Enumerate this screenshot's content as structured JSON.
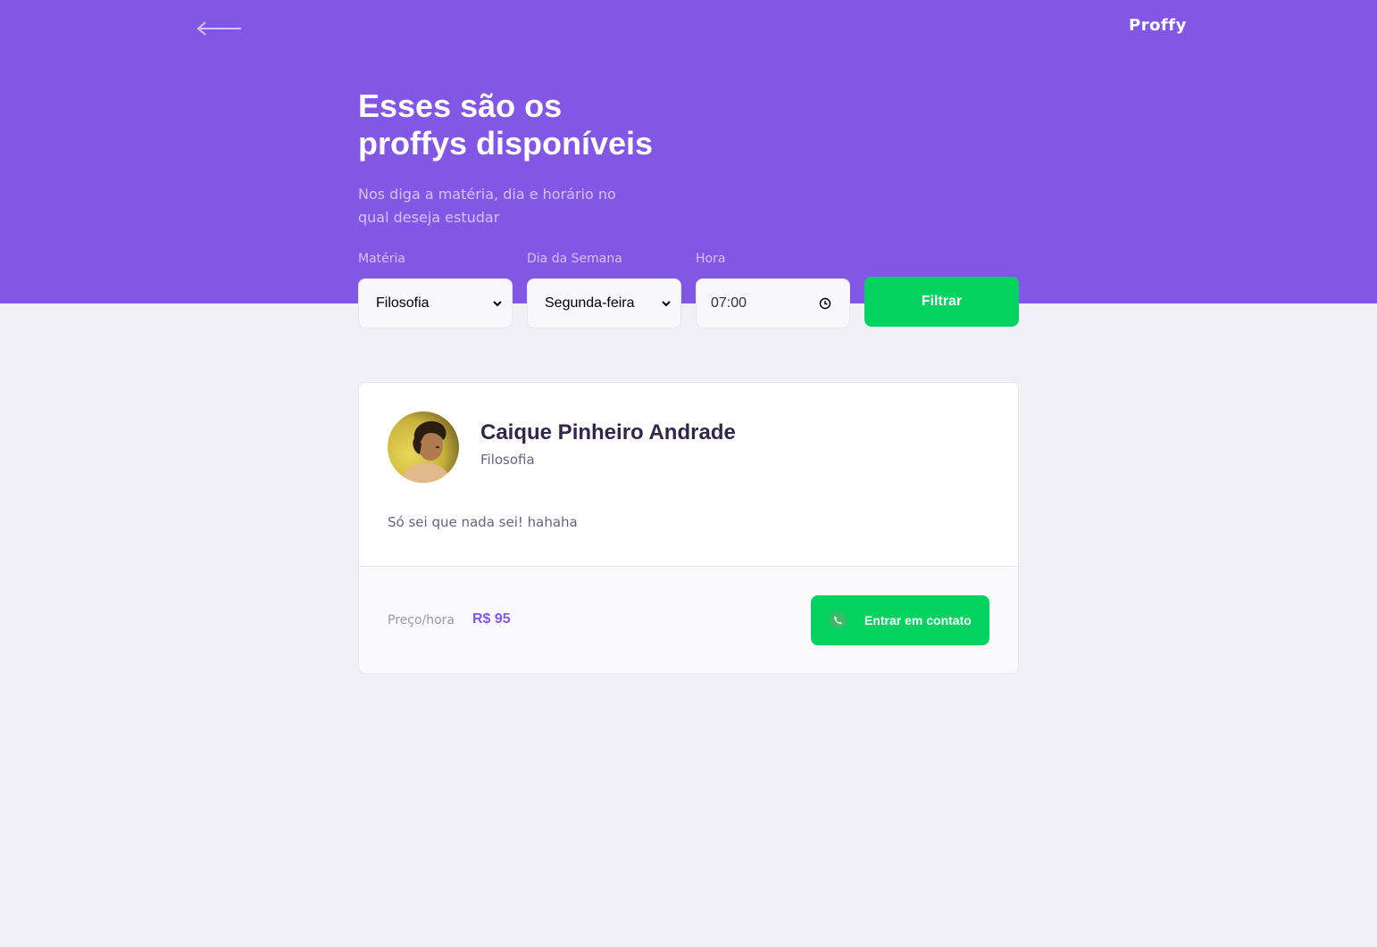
{
  "header": {
    "logo": "Proffy",
    "title_line1": "Esses são os",
    "title_line2": "proffys disponíveis",
    "subtitle": "Nos diga a matéria, dia e horário no qual deseja estudar"
  },
  "filters": {
    "subject_label": "Matéria",
    "subject_value": "Filosofia",
    "weekday_label": "Dia da Semana",
    "weekday_value": "Segunda-feira",
    "time_label": "Hora",
    "time_value": "07:00",
    "submit_label": "Filtrar"
  },
  "teacher": {
    "name": "Caique Pinheiro Andrade",
    "subject": "Filosofia",
    "bio": "Só sei que nada sei! hahaha",
    "price_label": "Preço/hora",
    "price_value": "R$ 95",
    "contact_label": "Entrar em contato"
  },
  "colors": {
    "primary": "#8257e5",
    "secondary": "#04d361",
    "background": "#f0f0f6",
    "title_text": "#32264d",
    "body_text": "#6a6180"
  },
  "icons": {
    "back": "arrow-left-icon",
    "dropdown": "chevron-down-icon",
    "clock": "clock-icon",
    "contact": "whatsapp-icon"
  }
}
